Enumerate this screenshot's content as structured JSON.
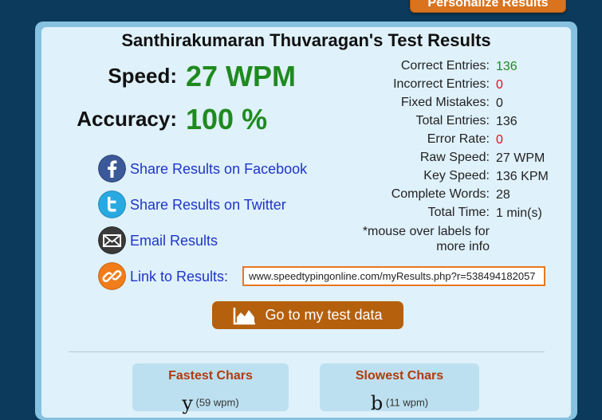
{
  "header": {
    "personalize_button": "Personalize Results"
  },
  "results": {
    "title": "Santhirakumaran Thuvaragan's Test Results",
    "speed_label": "Speed:",
    "speed_value": "27 WPM",
    "accuracy_label": "Accuracy:",
    "accuracy_value": "100 %"
  },
  "stats": [
    {
      "label": "Correct Entries:",
      "value": "136",
      "color": "#1f8a1f"
    },
    {
      "label": "Incorrect Entries:",
      "value": "0",
      "color": "#e01010"
    },
    {
      "label": "Fixed Mistakes:",
      "value": "0",
      "color": "#222222"
    },
    {
      "label": "Total Entries:",
      "value": "136",
      "color": "#222222"
    },
    {
      "label": "Error Rate:",
      "value": "0",
      "color": "#e01010"
    },
    {
      "label": "Raw Speed:",
      "value": "27 WPM",
      "color": "#222222"
    },
    {
      "label": "Key Speed:",
      "value": "136 KPM",
      "color": "#222222"
    },
    {
      "label": "Complete Words:",
      "value": "28",
      "color": "#222222"
    },
    {
      "label": "Total Time:",
      "value": "1 min(s)",
      "color": "#222222"
    }
  ],
  "note": {
    "line1": "*mouse over labels for",
    "line2": "more info"
  },
  "share": {
    "facebook": "Share Results on Facebook",
    "twitter": "Share Results on Twitter",
    "email": "Email Results",
    "link_label": "Link to Results:",
    "link_value": "www.speedtypingonline.com/myResults.php?r=538494182057"
  },
  "test_data_button": "Go to my test data",
  "fastest": {
    "title": "Fastest Chars",
    "char": "y",
    "speed": "(59 wpm)"
  },
  "slowest": {
    "title": "Slowest Chars",
    "char": "b",
    "speed": "(11 wpm)"
  },
  "colors": {
    "background": "#0b3a5c",
    "accent_orange": "#d9731d",
    "button_brown": "#b5600d",
    "value_green": "#1f8a1f",
    "link_blue": "#1f35c8",
    "error_red": "#e01010"
  }
}
